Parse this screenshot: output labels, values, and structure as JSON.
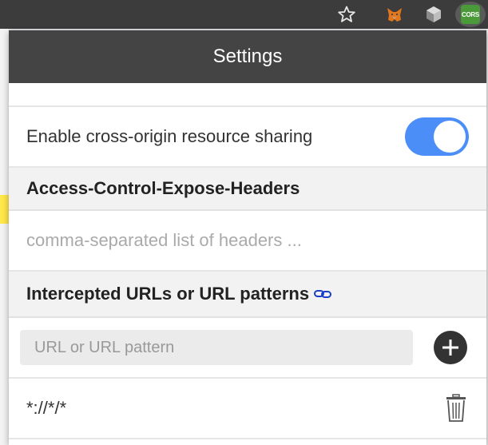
{
  "browser": {
    "icons": [
      "star-icon",
      "metamask-fox-icon",
      "cube-icon",
      "cors-extension-icon"
    ],
    "cors_badge": "CORS",
    "accent_color": "#4a9a3a"
  },
  "popup": {
    "title": "Settings",
    "enable_toggle": {
      "label": "Enable cross-origin resource sharing",
      "state": "on",
      "color": "#4c8ef7"
    },
    "expose_headers": {
      "title": "Access-Control-Expose-Headers",
      "value": "",
      "placeholder": "comma-separated list of headers ..."
    },
    "intercepted": {
      "title": "Intercepted URLs or URL patterns",
      "link_icon": "link-icon",
      "input_value": "",
      "input_placeholder": "URL or URL pattern",
      "add_icon": "plus-circle-icon",
      "patterns": [
        "*://*/*"
      ],
      "delete_icon": "trash-icon"
    }
  }
}
